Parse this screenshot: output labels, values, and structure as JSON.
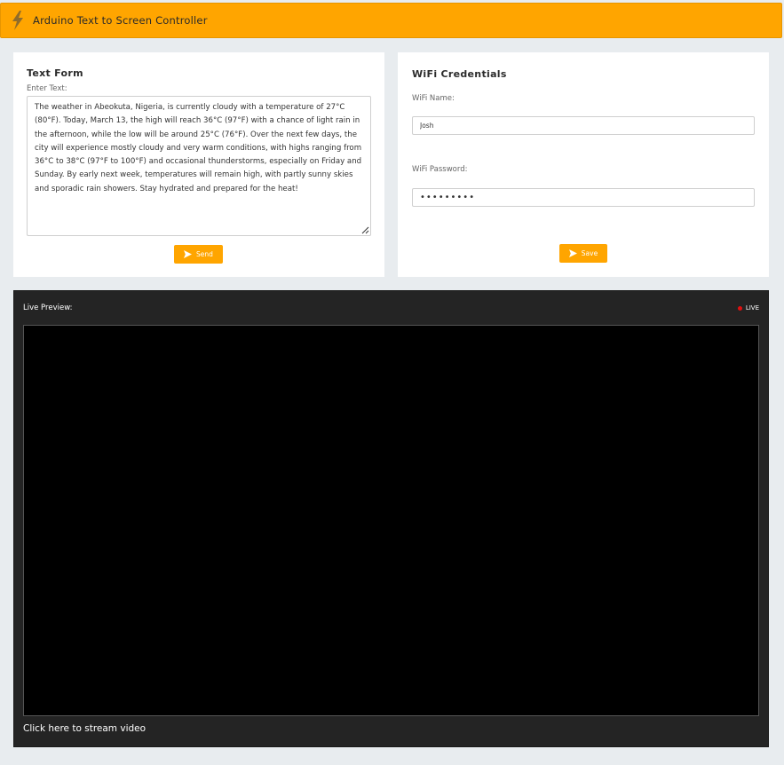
{
  "header": {
    "title": "Arduino Text to Screen Controller",
    "icon": "bolt-icon",
    "color": "#ffa500"
  },
  "text_form": {
    "title": "Text Form",
    "enter_label": "Enter Text:",
    "text_value": "The weather in Abeokuta, Nigeria, is currently cloudy with a temperature of 27°C (80°F). Today, March 13, the high will reach 36°C (97°F) with a chance of light rain in the afternoon, while the low will be around 25°C (76°F). Over the next few days, the city will experience mostly cloudy and very warm conditions, with highs ranging from 36°C to 38°C (97°F to 100°F) and occasional thunderstorms, especially on Friday and Sunday. By early next week, temperatures will remain high, with partly sunny skies and sporadic rain showers. Stay hydrated and prepared for the heat!",
    "send_label": "Send"
  },
  "wifi": {
    "title": "WiFi Credentials",
    "name_label": "WiFi Name:",
    "name_value": "Josh",
    "password_label": "WiFi Password:",
    "password_value": "josh12345",
    "save_label": "Save"
  },
  "preview": {
    "label": "Live Preview:",
    "live_label": "LIVE",
    "live_color": "#e01010",
    "stream_link": "Click here to stream video"
  }
}
